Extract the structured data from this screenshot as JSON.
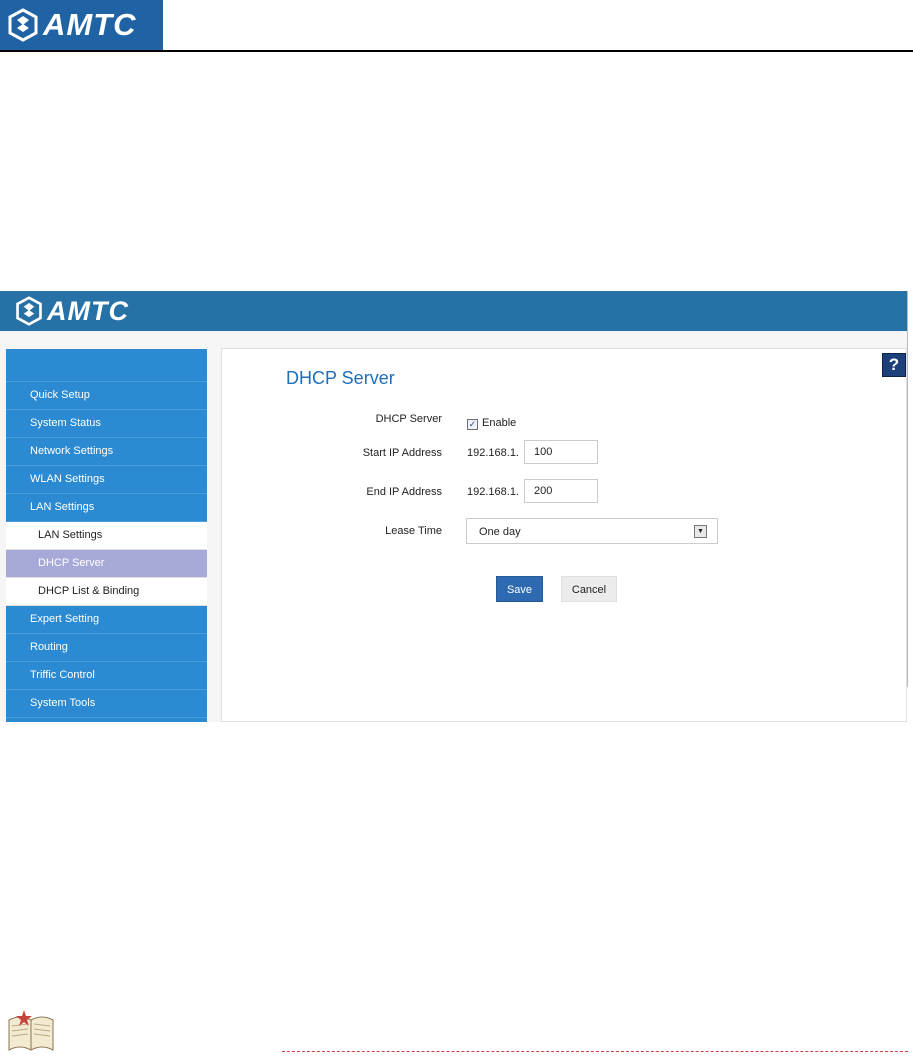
{
  "brand": {
    "name": "AMTC"
  },
  "router": {
    "brand": "AMTC",
    "help_symbol": "?",
    "nav": {
      "items": [
        {
          "label": "Quick Setup"
        },
        {
          "label": "System Status"
        },
        {
          "label": "Network Settings"
        },
        {
          "label": "WLAN Settings"
        },
        {
          "label": "LAN Settings"
        },
        {
          "label": "Expert Setting"
        },
        {
          "label": "Routing"
        },
        {
          "label": "Triffic Control"
        },
        {
          "label": "System Tools"
        }
      ],
      "lan_sub": [
        {
          "label": "LAN Settings",
          "active": false
        },
        {
          "label": "DHCP Server",
          "active": true
        },
        {
          "label": "DHCP List & Binding",
          "active": false
        }
      ]
    },
    "page": {
      "title": "DHCP Server",
      "fields": {
        "dhcp_server": {
          "label": "DHCP Server",
          "checked": true,
          "check_symbol": "✓",
          "option_label": "Enable"
        },
        "start_ip": {
          "label": "Start IP Address",
          "prefix": "192.168.1.",
          "value": "100"
        },
        "end_ip": {
          "label": "End IP Address",
          "prefix": "192.168.1.",
          "value": "200"
        },
        "lease_time": {
          "label": "Lease Time",
          "selected": "One day"
        }
      },
      "buttons": {
        "save": "Save",
        "cancel": "Cancel"
      }
    }
  },
  "colors": {
    "brand_blue": "#1f63a4",
    "header_blue": "#2671a6",
    "sidebar_blue": "#2b8ad2",
    "active_item": "#a7a9d8",
    "title_blue": "#1e6fb8",
    "save_button": "#2d6ab1"
  },
  "icons": [
    "amtc-logo-icon",
    "help-icon",
    "checkbox-checked-icon",
    "dropdown-arrow-icon",
    "book-icon"
  ]
}
